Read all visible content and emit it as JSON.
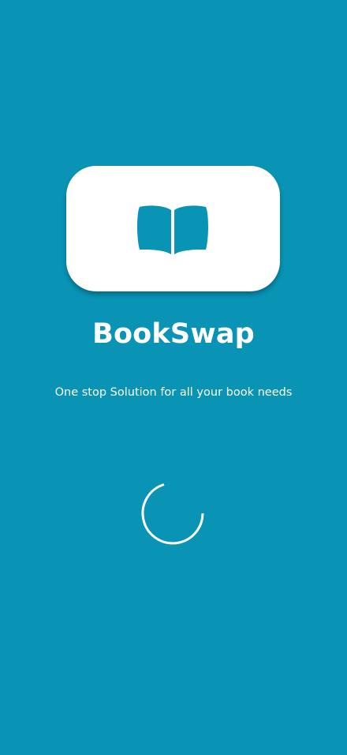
{
  "app": {
    "title": "BookSwap",
    "tagline": "One stop Solution for all your book needs"
  },
  "icons": {
    "logo": "open-book-icon",
    "loading": "loading-spinner"
  },
  "colors": {
    "background": "#0993b5",
    "card": "#ffffff",
    "text": "#ffffff",
    "icon": "#0993b5"
  }
}
